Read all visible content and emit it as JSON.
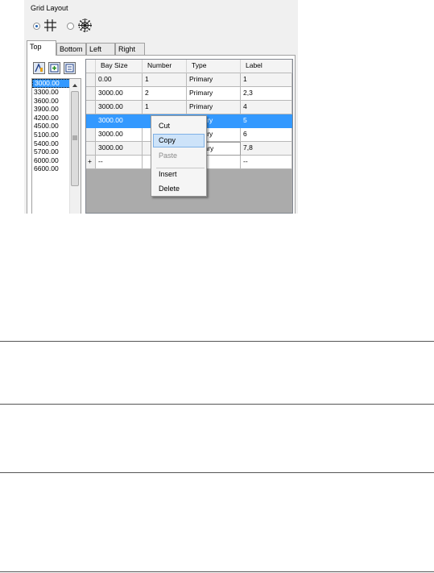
{
  "panel": {
    "title": "Grid Layout",
    "grid_options": [
      {
        "icon": "rectangular-grid-icon",
        "selected": true
      },
      {
        "icon": "radial-grid-icon",
        "selected": false
      }
    ]
  },
  "tabs": [
    {
      "label": "Top",
      "active": true
    },
    {
      "label": "Bottom",
      "active": false
    },
    {
      "label": "Left",
      "active": false
    },
    {
      "label": "Right",
      "active": false
    }
  ],
  "toolbar_icons": [
    "auto-fill-icon",
    "insert-row-icon",
    "delete-row-icon"
  ],
  "bay_size_list": {
    "selected": "3000.00",
    "items": [
      "3000.00",
      "3300.00",
      "3600.00",
      "3900.00",
      "4200.00",
      "4500.00",
      "5100.00",
      "5400.00",
      "5700.00",
      "6000.00",
      "6600.00"
    ]
  },
  "grid": {
    "columns": [
      "Bay Size",
      "Number",
      "Type",
      "Label"
    ],
    "rows": [
      {
        "bay_size": "0.00",
        "number": "1",
        "type": "Primary",
        "label": "1"
      },
      {
        "bay_size": "3000.00",
        "number": "2",
        "type": "Primary",
        "label": "2,3"
      },
      {
        "bay_size": "3000.00",
        "number": "1",
        "type": "Primary",
        "label": "4"
      },
      {
        "bay_size": "3000.00",
        "number": "",
        "type": "Primary",
        "label": "5",
        "selected": true
      },
      {
        "bay_size": "3000.00",
        "number": "",
        "type": "Primary",
        "label": "6"
      },
      {
        "bay_size": "3000.00",
        "number": "",
        "type": "Primary",
        "label": "7,8"
      }
    ],
    "new_row": {
      "marker": "+",
      "bay_size": "--",
      "number": "",
      "type": "--",
      "label": "--"
    }
  },
  "context_menu": {
    "items": [
      {
        "label": "Cut",
        "enabled": true
      },
      {
        "label": "Copy",
        "enabled": true,
        "highlighted": true
      },
      {
        "label": "Paste",
        "enabled": false
      },
      {
        "label": "Insert",
        "enabled": true
      },
      {
        "label": "Delete",
        "enabled": true
      }
    ]
  }
}
